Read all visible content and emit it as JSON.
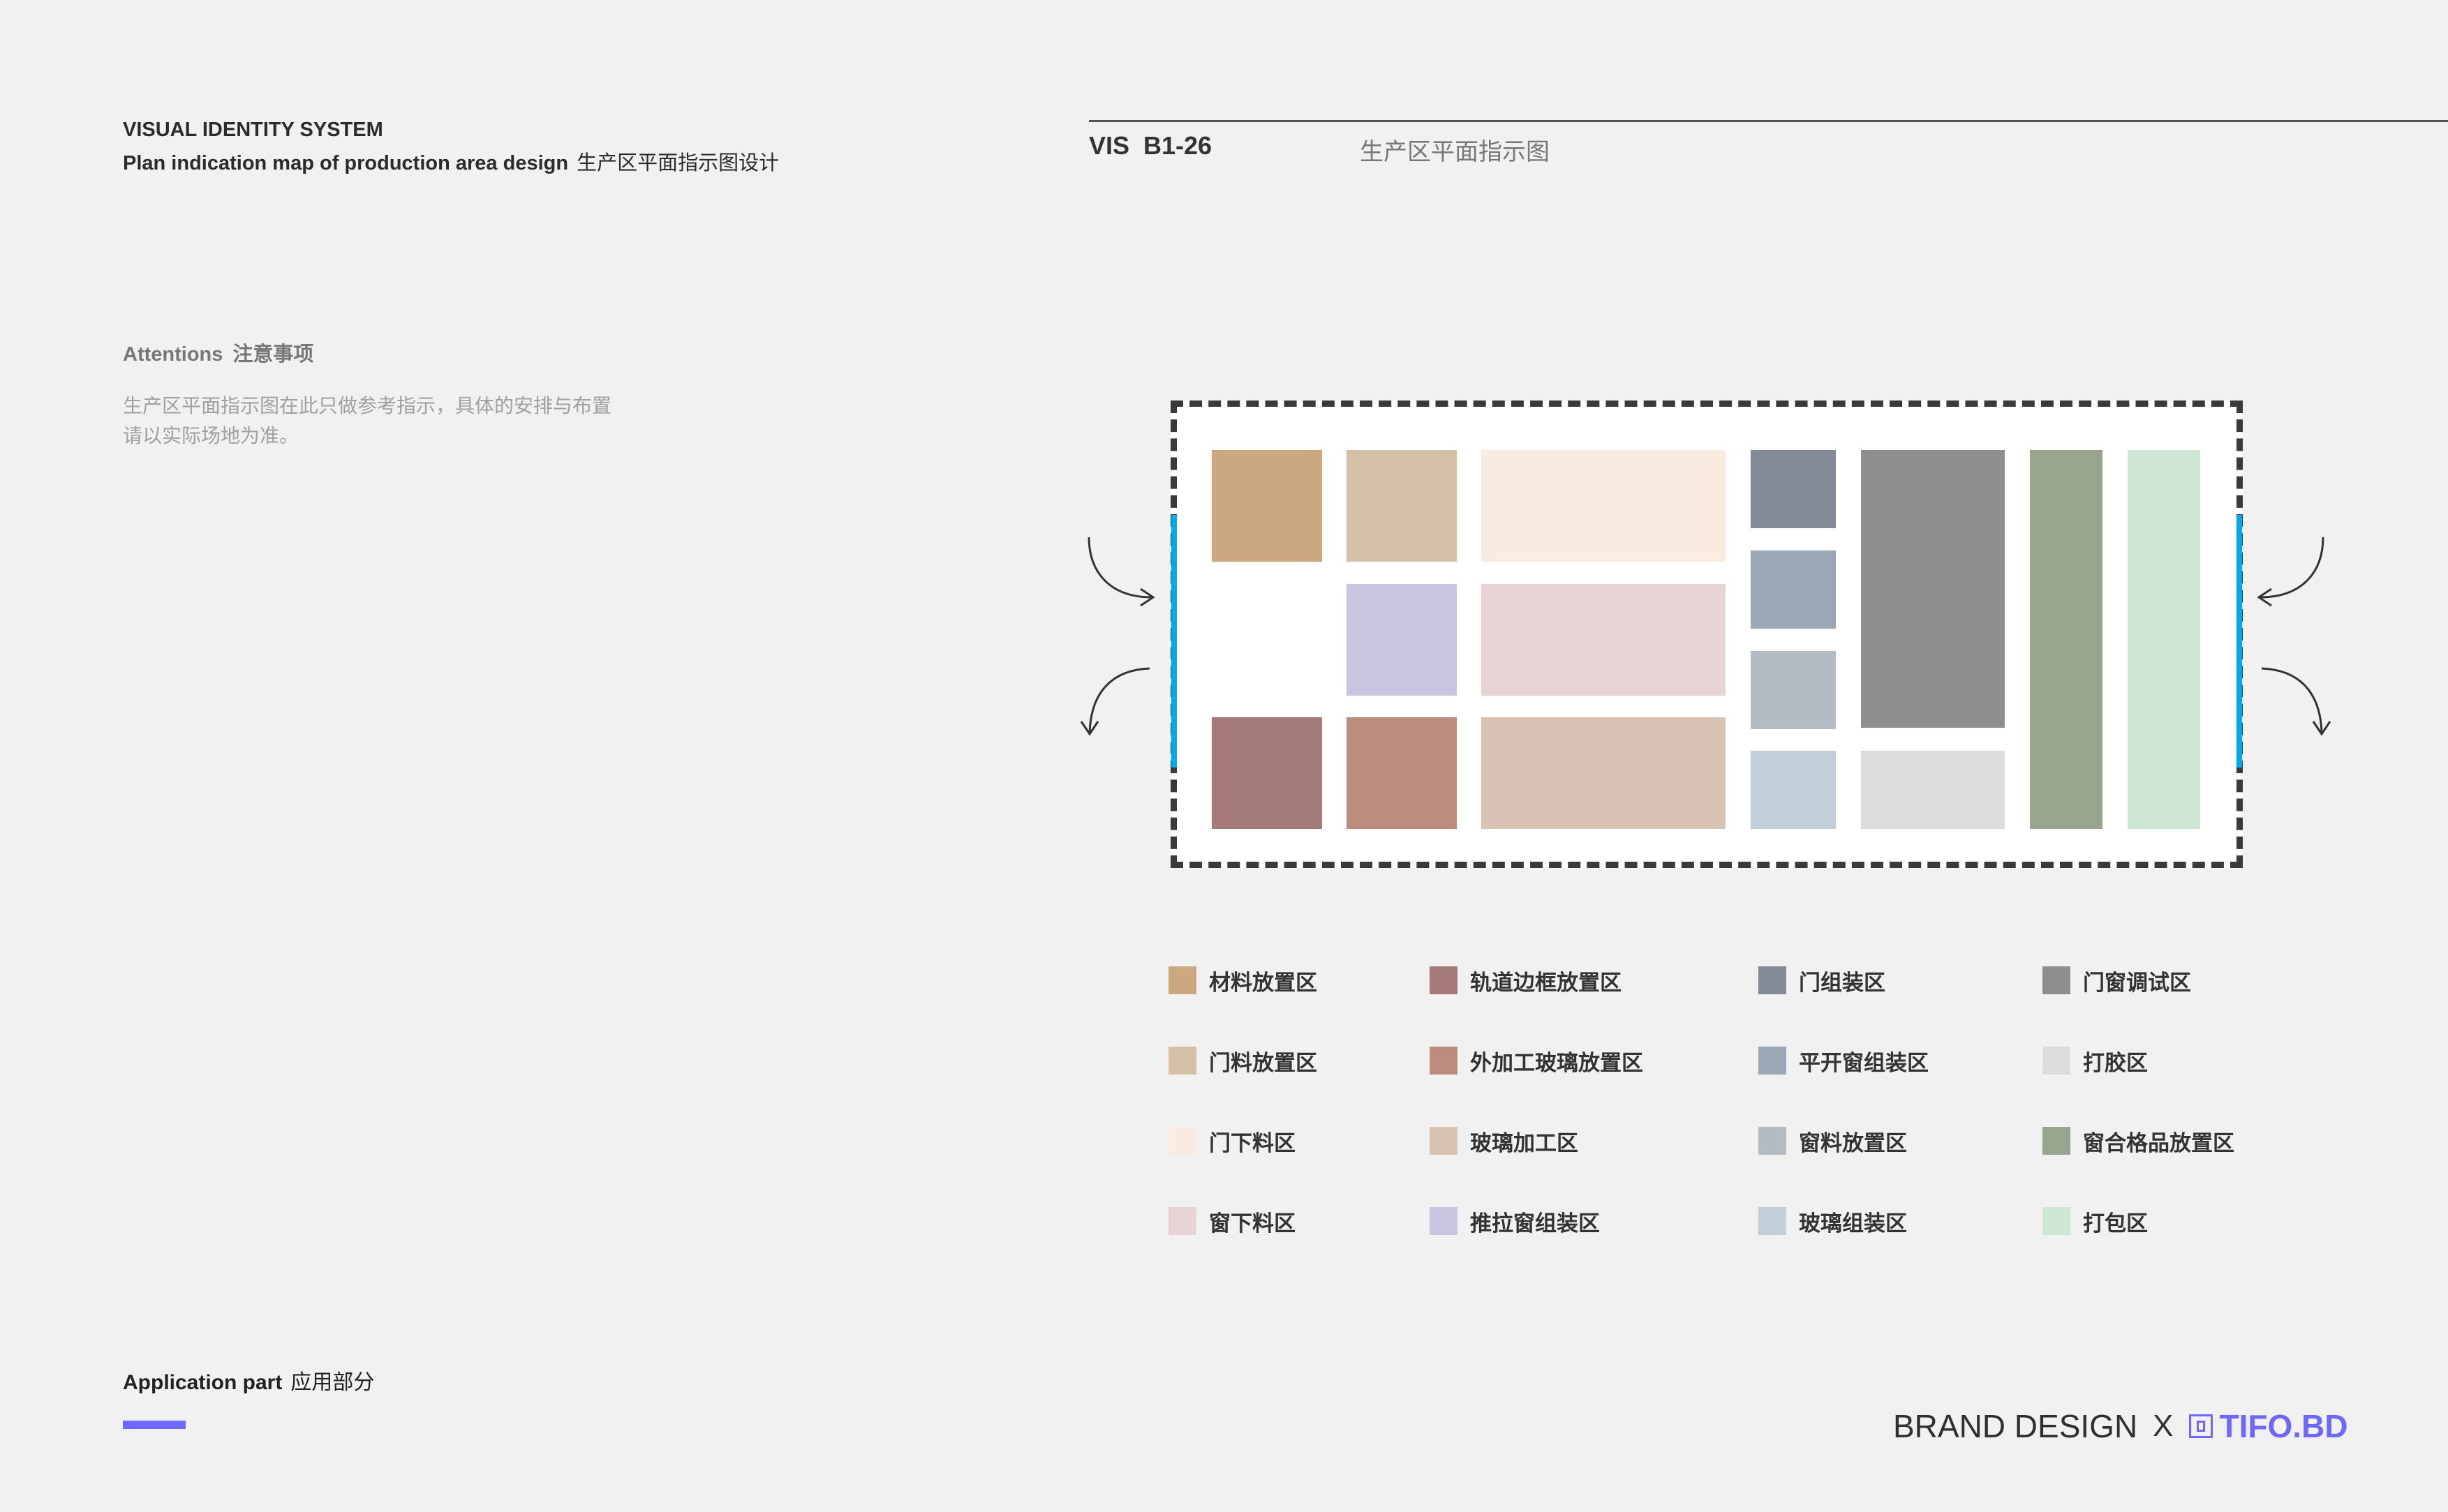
{
  "header": {
    "eyebrow": "VISUAL IDENTITY SYSTEM",
    "subtitle_en": "Plan indication map of production area design",
    "subtitle_cn": "生产区平面指示图设计"
  },
  "page": {
    "code": "VIS  B1-26",
    "heading": "生产区平面指示图"
  },
  "attentions": {
    "title_en": "Attentions",
    "title_cn": "注意事项",
    "body": "生产区平面指示图在此只做参考指示，具体的安排与布置请以实际场地为准。"
  },
  "colors": {
    "accent": "#6f68ff",
    "door_marker": "#00aaea",
    "material_storage": "#cba880",
    "rail_frame_storage": "#a57b7a",
    "door_assembly": "#818a96",
    "door_window_debug": "#8e8e8e",
    "door_material_storage": "#d3c0a7",
    "outsourced_glass_storage": "#bc8c7e",
    "casement_window_assembly": "#9ca7b5",
    "gluing": "#dcdcdc",
    "door_cutting": "#f9ebdf",
    "glass_processing": "#d9c3b5",
    "window_material_storage": "#b4bcc3",
    "window_grille_storage": "#99a48f",
    "window_cutting": "#e8d3d5",
    "sliding_window_assembly": "#c9c5e1",
    "glass_assembly": "#c0ced9",
    "packing": "#cde6d6"
  },
  "legend": [
    {
      "label": "材料放置区",
      "color_key": "material_storage"
    },
    {
      "label": "门料放置区",
      "color_key": "door_material_storage"
    },
    {
      "label": "门下料区",
      "color_key": "door_cutting"
    },
    {
      "label": "窗下料区",
      "color_key": "window_cutting"
    },
    {
      "label": "轨道边框放置区",
      "color_key": "rail_frame_storage"
    },
    {
      "label": "外加工玻璃放置区",
      "color_key": "outsourced_glass_storage"
    },
    {
      "label": "玻璃加工区",
      "color_key": "glass_processing"
    },
    {
      "label": "推拉窗组装区",
      "color_key": "sliding_window_assembly"
    },
    {
      "label": "门组装区",
      "color_key": "door_assembly"
    },
    {
      "label": "平开窗组装区",
      "color_key": "casement_window_assembly"
    },
    {
      "label": "窗料放置区",
      "color_key": "window_material_storage"
    },
    {
      "label": "玻璃组装区",
      "color_key": "glass_assembly"
    },
    {
      "label": "门窗调试区",
      "color_key": "door_window_debug"
    },
    {
      "label": "打胶区",
      "color_key": "gluing"
    },
    {
      "label": "窗合格品放置区",
      "color_key": "window_grille_storage"
    },
    {
      "label": "打包区",
      "color_key": "packing"
    }
  ],
  "footer": {
    "app_part_en": "Application part",
    "app_part_cn": "应用部分",
    "brand": "BRAND DESIGN",
    "brand_x": "X",
    "logo_text": "TIFO.BD",
    "logo_icon": "tifo-logo-icon"
  }
}
